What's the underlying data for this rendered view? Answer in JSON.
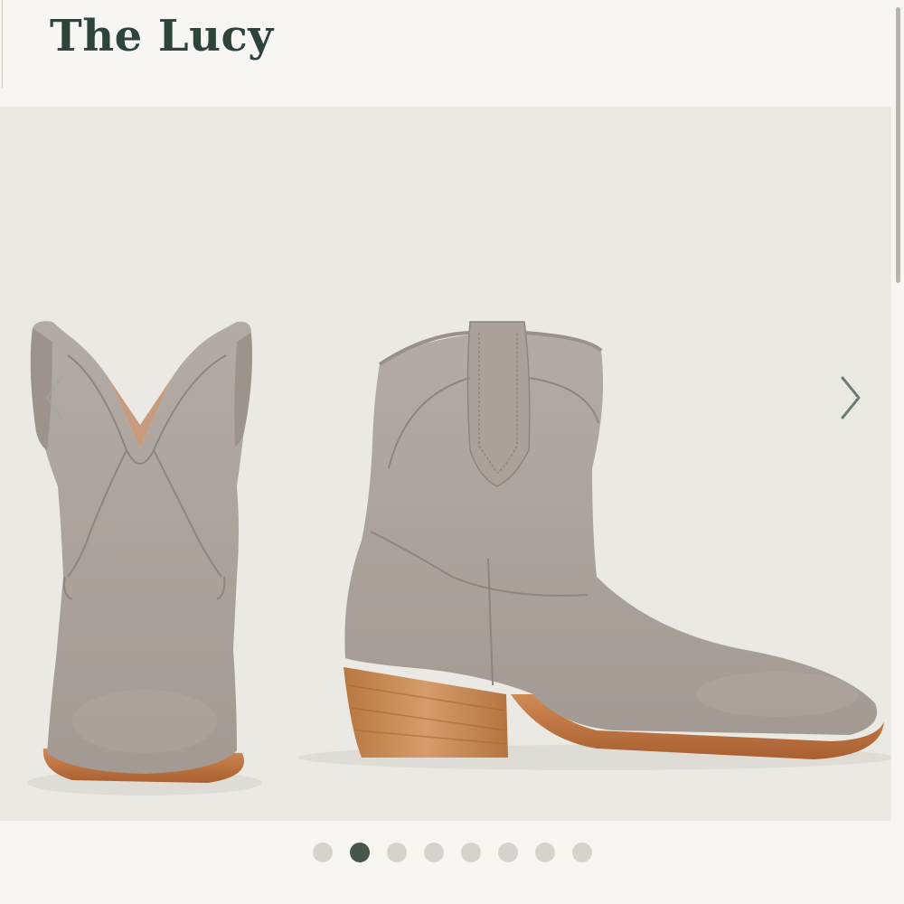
{
  "product": {
    "title": "The Lucy"
  },
  "gallery": {
    "image_description_icon": "product-photo",
    "prev_icon": "chevron-left-icon",
    "next_icon": "chevron-right-icon",
    "total_slides": 8,
    "active_slide": 2
  },
  "colors": {
    "title_color": "#2d4438",
    "gallery_bg": "#ebe9e3",
    "dot_active": "#465649",
    "dot_inactive": "#d6d3cd",
    "boot_suede": "#a9a09a",
    "heel_wood": "#c68a57"
  }
}
